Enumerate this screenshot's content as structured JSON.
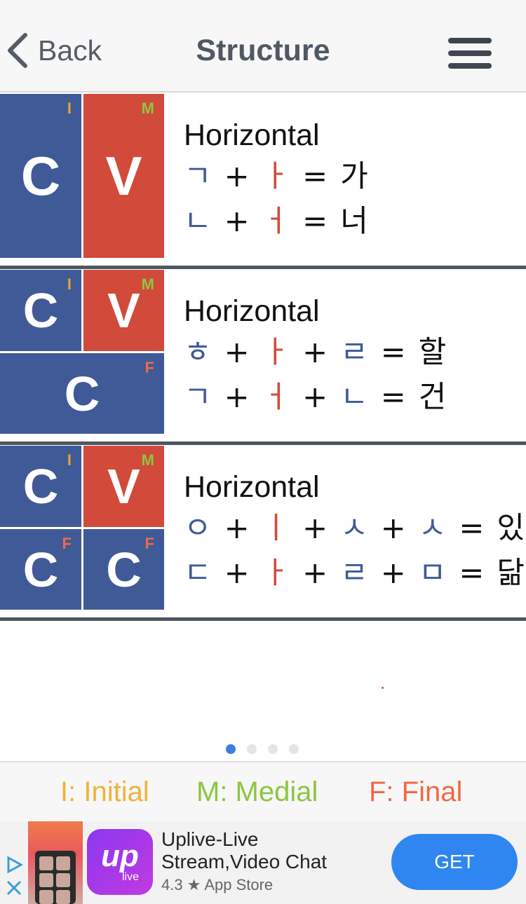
{
  "nav": {
    "back_label": "Back",
    "title": "Structure"
  },
  "cards": [
    {
      "title": "Horizontal",
      "diagram": {
        "top_left": "C",
        "top_right": "V",
        "tag_initial": "I",
        "tag_medial": "M"
      },
      "equations": [
        [
          "ㄱ",
          "+",
          "ㅏ",
          "=",
          "가"
        ],
        [
          "ㄴ",
          "+",
          "ㅓ",
          "=",
          "너"
        ]
      ]
    },
    {
      "title": "Horizontal",
      "diagram": {
        "top_left": "C",
        "top_right": "V",
        "bottom": "C",
        "tag_initial": "I",
        "tag_medial": "M",
        "tag_final": "F"
      },
      "equations": [
        [
          "ㅎ",
          "+",
          "ㅏ",
          "+",
          "ㄹ",
          "=",
          "할"
        ],
        [
          "ㄱ",
          "+",
          "ㅓ",
          "+",
          "ㄴ",
          "=",
          "건"
        ]
      ]
    },
    {
      "title": "Horizontal",
      "diagram": {
        "top_left": "C",
        "top_right": "V",
        "bottom_left": "C",
        "bottom_right": "C",
        "tag_initial": "I",
        "tag_medial": "M",
        "tag_final": "F"
      },
      "equations": [
        [
          "ㅇ",
          "+",
          "ㅣ",
          "+",
          "ㅅ",
          "+",
          "ㅅ",
          "=",
          "있"
        ],
        [
          "ㄷ",
          "+",
          "ㅏ",
          "+",
          "ㄹ",
          "+",
          "ㅁ",
          "=",
          "닮"
        ]
      ]
    }
  ],
  "pager": {
    "count": 4,
    "active_index": 0
  },
  "legend": {
    "initial": "I: Initial",
    "medial": "M: Medial",
    "final": "F: Final"
  },
  "ad": {
    "app_name": "Uplive-Live Stream,Video Chat",
    "rating_line": "4.3 ★ App Store",
    "icon_text": "up",
    "icon_subtext": "live",
    "get_label": "GET"
  },
  "colors": {
    "consonant": "#3f5a97",
    "vowel": "#d24a3a",
    "initial": "#f0b23a",
    "medial": "#8cc63f",
    "final": "#f06a45",
    "accent": "#2f86f0"
  }
}
